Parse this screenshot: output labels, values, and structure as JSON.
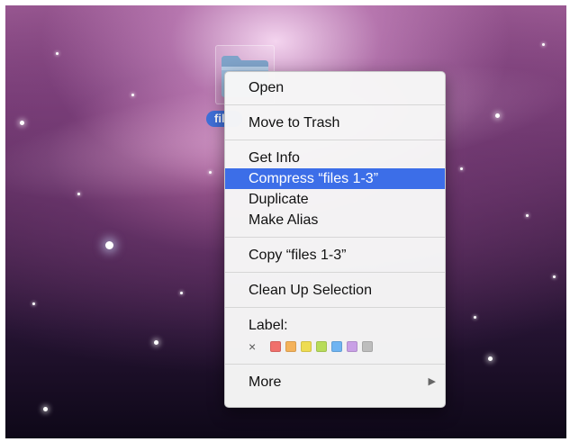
{
  "desktop": {
    "selected_item": {
      "name_visible": "fil",
      "icon": "folder-icon"
    }
  },
  "context_menu": {
    "open": "Open",
    "move_to_trash": "Move to Trash",
    "get_info": "Get Info",
    "compress": "Compress “files 1-3”",
    "duplicate": "Duplicate",
    "make_alias": "Make Alias",
    "copy": "Copy “files 1-3”",
    "clean_up_selection": "Clean Up Selection",
    "label_heading": "Label:",
    "label_none_symbol": "×",
    "label_colors": [
      {
        "name": "red",
        "color": "#f0706c"
      },
      {
        "name": "orange",
        "color": "#f4b25a"
      },
      {
        "name": "yellow",
        "color": "#eedc52"
      },
      {
        "name": "green",
        "color": "#b8dc5a"
      },
      {
        "name": "blue",
        "color": "#6fb4f2"
      },
      {
        "name": "purple",
        "color": "#c9a0e6"
      },
      {
        "name": "gray",
        "color": "#bdbdbd"
      }
    ],
    "more": "More",
    "more_arrow": "▶",
    "highlighted_item": "compress",
    "highlight_color": "#3c6ee8"
  }
}
